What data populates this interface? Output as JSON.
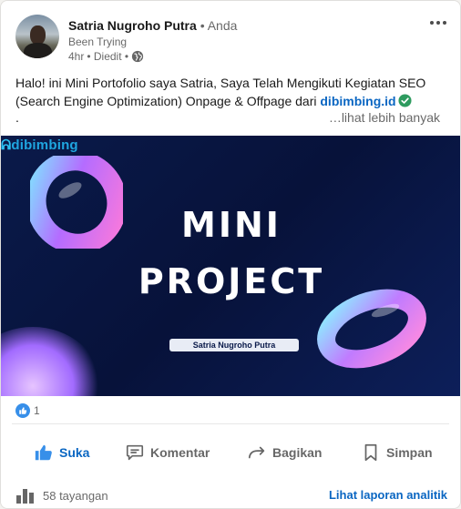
{
  "post": {
    "author": {
      "name": "Satria Nugroho Putra",
      "relation": "• Anda",
      "headline": "Been Trying",
      "time": "4hr",
      "edited": "• Diedit •",
      "visibility_icon": "globe-icon"
    },
    "more_icon": "more-horizontal-icon",
    "text": {
      "body": "Halo! ini Mini Portofolio saya Satria, Saya Telah Mengikuti Kegiatan SEO (Search Engine Optimization) Onpage & Offpage dari ",
      "link": "dibimbing.id",
      "link_badge_icon": "verified-check-icon",
      "trailing": ".",
      "see_more": "…lihat lebih banyak"
    },
    "image": {
      "brand": "dibimbing",
      "line1": "MINI",
      "line2": "PROJECT",
      "name_tag": "Satria Nugroho Putra"
    },
    "reactions": {
      "icon": "like-reaction-icon",
      "count": "1"
    },
    "actions": [
      {
        "label": "Suka",
        "icon": "thumbs-up-icon",
        "active": true
      },
      {
        "label": "Komentar",
        "icon": "comment-icon",
        "active": false
      },
      {
        "label": "Bagikan",
        "icon": "share-arrow-icon",
        "active": false
      },
      {
        "label": "Simpan",
        "icon": "bookmark-icon",
        "active": false
      }
    ],
    "footer": {
      "views_icon": "bar-chart-icon",
      "views": "58 tayangan",
      "analytics_link": "Lihat laporan analitik"
    }
  },
  "colors": {
    "accent": "#0a66c2",
    "banner_bg": "#0a1a4a",
    "brand": "#1fa6e0",
    "verified": "#2e9b5f"
  }
}
